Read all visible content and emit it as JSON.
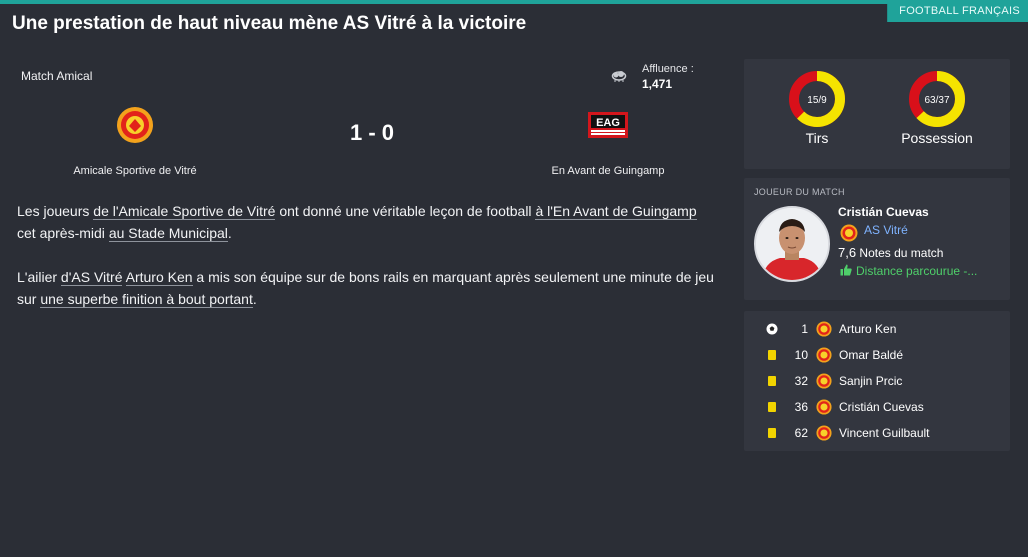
{
  "category": "FOOTBALL FRANÇAIS",
  "headline": "Une prestation de haut niveau mène AS Vitré à la victoire",
  "match": {
    "type": "Match Amical",
    "attendance_label": "Affluence :",
    "attendance_value": "1,471",
    "score": "1 - 0",
    "home_team": "Amicale Sportive de Vitré",
    "away_team": "En Avant de Guingamp",
    "away_crest_text": "EAG"
  },
  "article": {
    "p1": {
      "t1": "Les joueurs ",
      "l1": "de l'Amicale Sportive de Vitré",
      "t2": " ont donné une véritable leçon de football ",
      "l2": "à l'En Avant de Guingamp",
      "t3": " cet après-midi ",
      "l3": "au Stade Municipal",
      "t4": "."
    },
    "p2": {
      "t1": "L'ailier ",
      "l1": "d'AS Vitré",
      "t2": " ",
      "l2": "Arturo Ken",
      "t3": " a mis son équipe sur de bons rails en marquant après seulement une minute de jeu sur ",
      "l3": "une superbe finition à bout portant",
      "t4": "."
    }
  },
  "stats": {
    "shots": {
      "label": "Tirs",
      "value_text": "15/9",
      "home": 15,
      "away": 9
    },
    "possession": {
      "label": "Possession",
      "value_text": "63/37",
      "home": 63,
      "away": 37
    },
    "colors": {
      "home": "#f5e400",
      "away": "#d9101a"
    }
  },
  "player_of_match": {
    "title": "JOUEUR DU MATCH",
    "name": "Cristián Cuevas",
    "club": "AS Vitré",
    "rating": "7,6",
    "rating_label": "Notes du match",
    "distance": "Distance parcourue -..."
  },
  "events": [
    {
      "type": "goal",
      "icon": "football-icon",
      "minute": "1",
      "player": "Arturo Ken"
    },
    {
      "type": "yellow",
      "icon": "yellow-card-icon",
      "minute": "10",
      "player": "Omar Baldé"
    },
    {
      "type": "yellow",
      "icon": "yellow-card-icon",
      "minute": "32",
      "player": "Sanjin Prcic"
    },
    {
      "type": "yellow",
      "icon": "yellow-card-icon",
      "minute": "36",
      "player": "Cristián Cuevas"
    },
    {
      "type": "yellow",
      "icon": "yellow-card-icon",
      "minute": "62",
      "player": "Vincent Guilbault"
    }
  ]
}
